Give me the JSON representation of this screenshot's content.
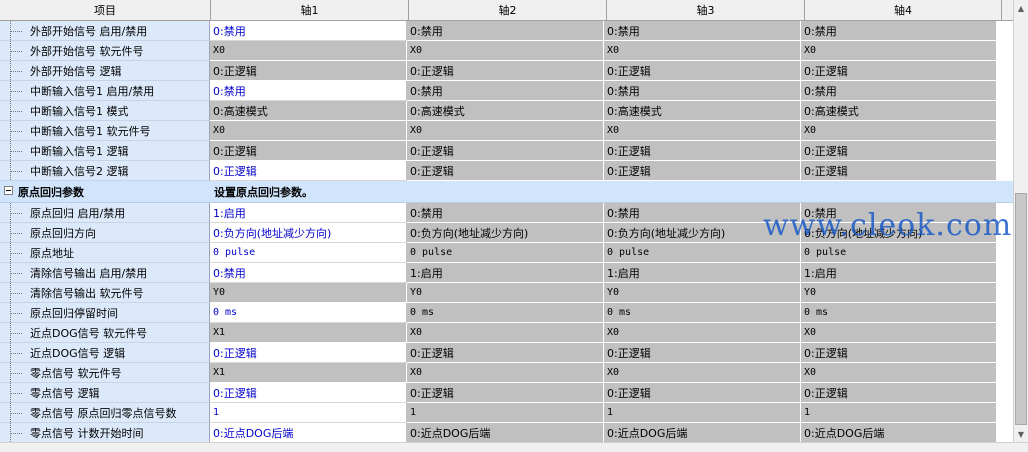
{
  "header": {
    "col0": "项目",
    "axes": [
      "轴1",
      "轴2",
      "轴3",
      "轴4"
    ]
  },
  "rows_top": [
    {
      "label": "外部开始信号 启用/禁用",
      "values": [
        "0:禁用",
        "0:禁用",
        "0:禁用",
        "0:禁用"
      ],
      "editable": true,
      "mono": false
    },
    {
      "label": "外部开始信号  软元件号",
      "values": [
        "X0",
        "X0",
        "X0",
        "X0"
      ],
      "editable": false,
      "mono": true
    },
    {
      "label": "外部开始信号  逻辑",
      "values": [
        "0:正逻辑",
        "0:正逻辑",
        "0:正逻辑",
        "0:正逻辑"
      ],
      "editable": false,
      "mono": false
    },
    {
      "label": "中断输入信号1 启用/禁用",
      "values": [
        "0:禁用",
        "0:禁用",
        "0:禁用",
        "0:禁用"
      ],
      "editable": true,
      "mono": false
    },
    {
      "label": "中断输入信号1  模式",
      "values": [
        "0:高速模式",
        "0:高速模式",
        "0:高速模式",
        "0:高速模式"
      ],
      "editable": false,
      "mono": false
    },
    {
      "label": "中断输入信号1  软元件号",
      "values": [
        "X0",
        "X0",
        "X0",
        "X0"
      ],
      "editable": false,
      "mono": true
    },
    {
      "label": "中断输入信号1 逻辑",
      "values": [
        "0:正逻辑",
        "0:正逻辑",
        "0:正逻辑",
        "0:正逻辑"
      ],
      "editable": false,
      "mono": false
    },
    {
      "label": "中断输入信号2 逻辑",
      "values": [
        "0:正逻辑",
        "0:正逻辑",
        "0:正逻辑",
        "0:正逻辑"
      ],
      "editable": true,
      "mono": false
    }
  ],
  "section": {
    "title": "原点回归参数",
    "description": "设置原点回归参数。"
  },
  "rows_bottom": [
    {
      "label": "原点回归  启用/禁用",
      "values": [
        "1:启用",
        "0:禁用",
        "0:禁用",
        "0:禁用"
      ],
      "editable": true,
      "mono": false
    },
    {
      "label": "原点回归方向",
      "values": [
        "0:负方向(地址减少方向)",
        "0:负方向(地址减少方向)",
        "0:负方向(地址减少方向)",
        "0:负方向(地址减少方向)"
      ],
      "editable": true,
      "mono": false
    },
    {
      "label": "原点地址",
      "values": [
        "0 pulse",
        "0 pulse",
        "0 pulse",
        "0 pulse"
      ],
      "editable": true,
      "mono": true
    },
    {
      "label": "清除信号输出 启用/禁用",
      "values": [
        "0:禁用",
        "1:启用",
        "1:启用",
        "1:启用"
      ],
      "editable": true,
      "mono": false
    },
    {
      "label": "清除信号输出 软元件号",
      "values": [
        "Y0",
        "Y0",
        "Y0",
        "Y0"
      ],
      "editable": false,
      "mono": true
    },
    {
      "label": "原点回归停留时间",
      "values": [
        "0 ms",
        "0 ms",
        "0 ms",
        "0 ms"
      ],
      "editable": true,
      "mono": true
    },
    {
      "label": "近点DOG信号  软元件号",
      "values": [
        "X1",
        "X0",
        "X0",
        "X0"
      ],
      "editable": false,
      "mono": true
    },
    {
      "label": "近点DOG信号 逻辑",
      "values": [
        "0:正逻辑",
        "0:正逻辑",
        "0:正逻辑",
        "0:正逻辑"
      ],
      "editable": true,
      "mono": false
    },
    {
      "label": "零点信号  软元件号",
      "values": [
        "X1",
        "X0",
        "X0",
        "X0"
      ],
      "editable": false,
      "mono": true
    },
    {
      "label": "零点信号 逻辑",
      "values": [
        "0:正逻辑",
        "0:正逻辑",
        "0:正逻辑",
        "0:正逻辑"
      ],
      "editable": true,
      "mono": false
    },
    {
      "label": "零点信号  原点回归零点信号数",
      "values": [
        "1",
        "1",
        "1",
        "1"
      ],
      "editable": true,
      "mono": true
    },
    {
      "label": "零点信号  计数开始时间",
      "values": [
        "0:近点DOG后端",
        "0:近点DOG后端",
        "0:近点DOG后端",
        "0:近点DOG后端"
      ],
      "editable": true,
      "mono": false
    }
  ],
  "watermark": "www.cleok.com",
  "colors": {
    "label_bg": "#dbe9fa",
    "readonly_bg": "#c0c0c0",
    "editable_value": "#0000cc",
    "watermark": "#1a5cc8"
  }
}
